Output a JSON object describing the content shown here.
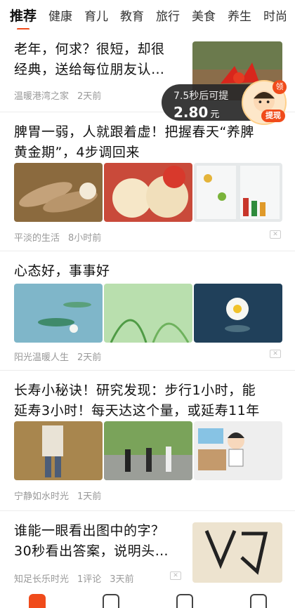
{
  "tabs": [
    "推荐",
    "健康",
    "育儿",
    "教育",
    "旅行",
    "美食",
    "养生",
    "时尚"
  ],
  "promo": {
    "hint": "7.5秒后可提",
    "amount": "2.80",
    "unit": "元",
    "badge": "领",
    "cta": "提现"
  },
  "articles": [
    {
      "title_lines": [
        "老年，何求？很短，却很",
        "经典，送给每位朋友认…"
      ],
      "author": "温暖港湾之家",
      "time": "2天前"
    },
    {
      "title_lines": [
        "脾胃一弱，人就跟着虚！把握春天“养脾",
        "黄金期”，4步调回来"
      ],
      "author": "平淡的生活",
      "time": "8小时前"
    },
    {
      "title_lines": [
        "心态好，事事好"
      ],
      "author": "阳光温暖人生",
      "time": "2天前"
    },
    {
      "title_lines": [
        "长寿小秘诀！研究发现：步行1小时，能",
        "延寿3小时！每天达这个量，或延寿11年"
      ],
      "author": "宁静如水时光",
      "time": "1天前"
    },
    {
      "title_lines": [
        "谁能一眼看出图中的字？",
        "30秒看出答案，说明头…"
      ],
      "author": "知足长乐时光",
      "comments": "1评论",
      "time": "3天前"
    }
  ],
  "icons": {
    "close": "close-icon",
    "nav": [
      "home-icon",
      "video-icon",
      "task-icon",
      "profile-icon"
    ]
  },
  "colors": {
    "accent": "#f04b1b"
  }
}
